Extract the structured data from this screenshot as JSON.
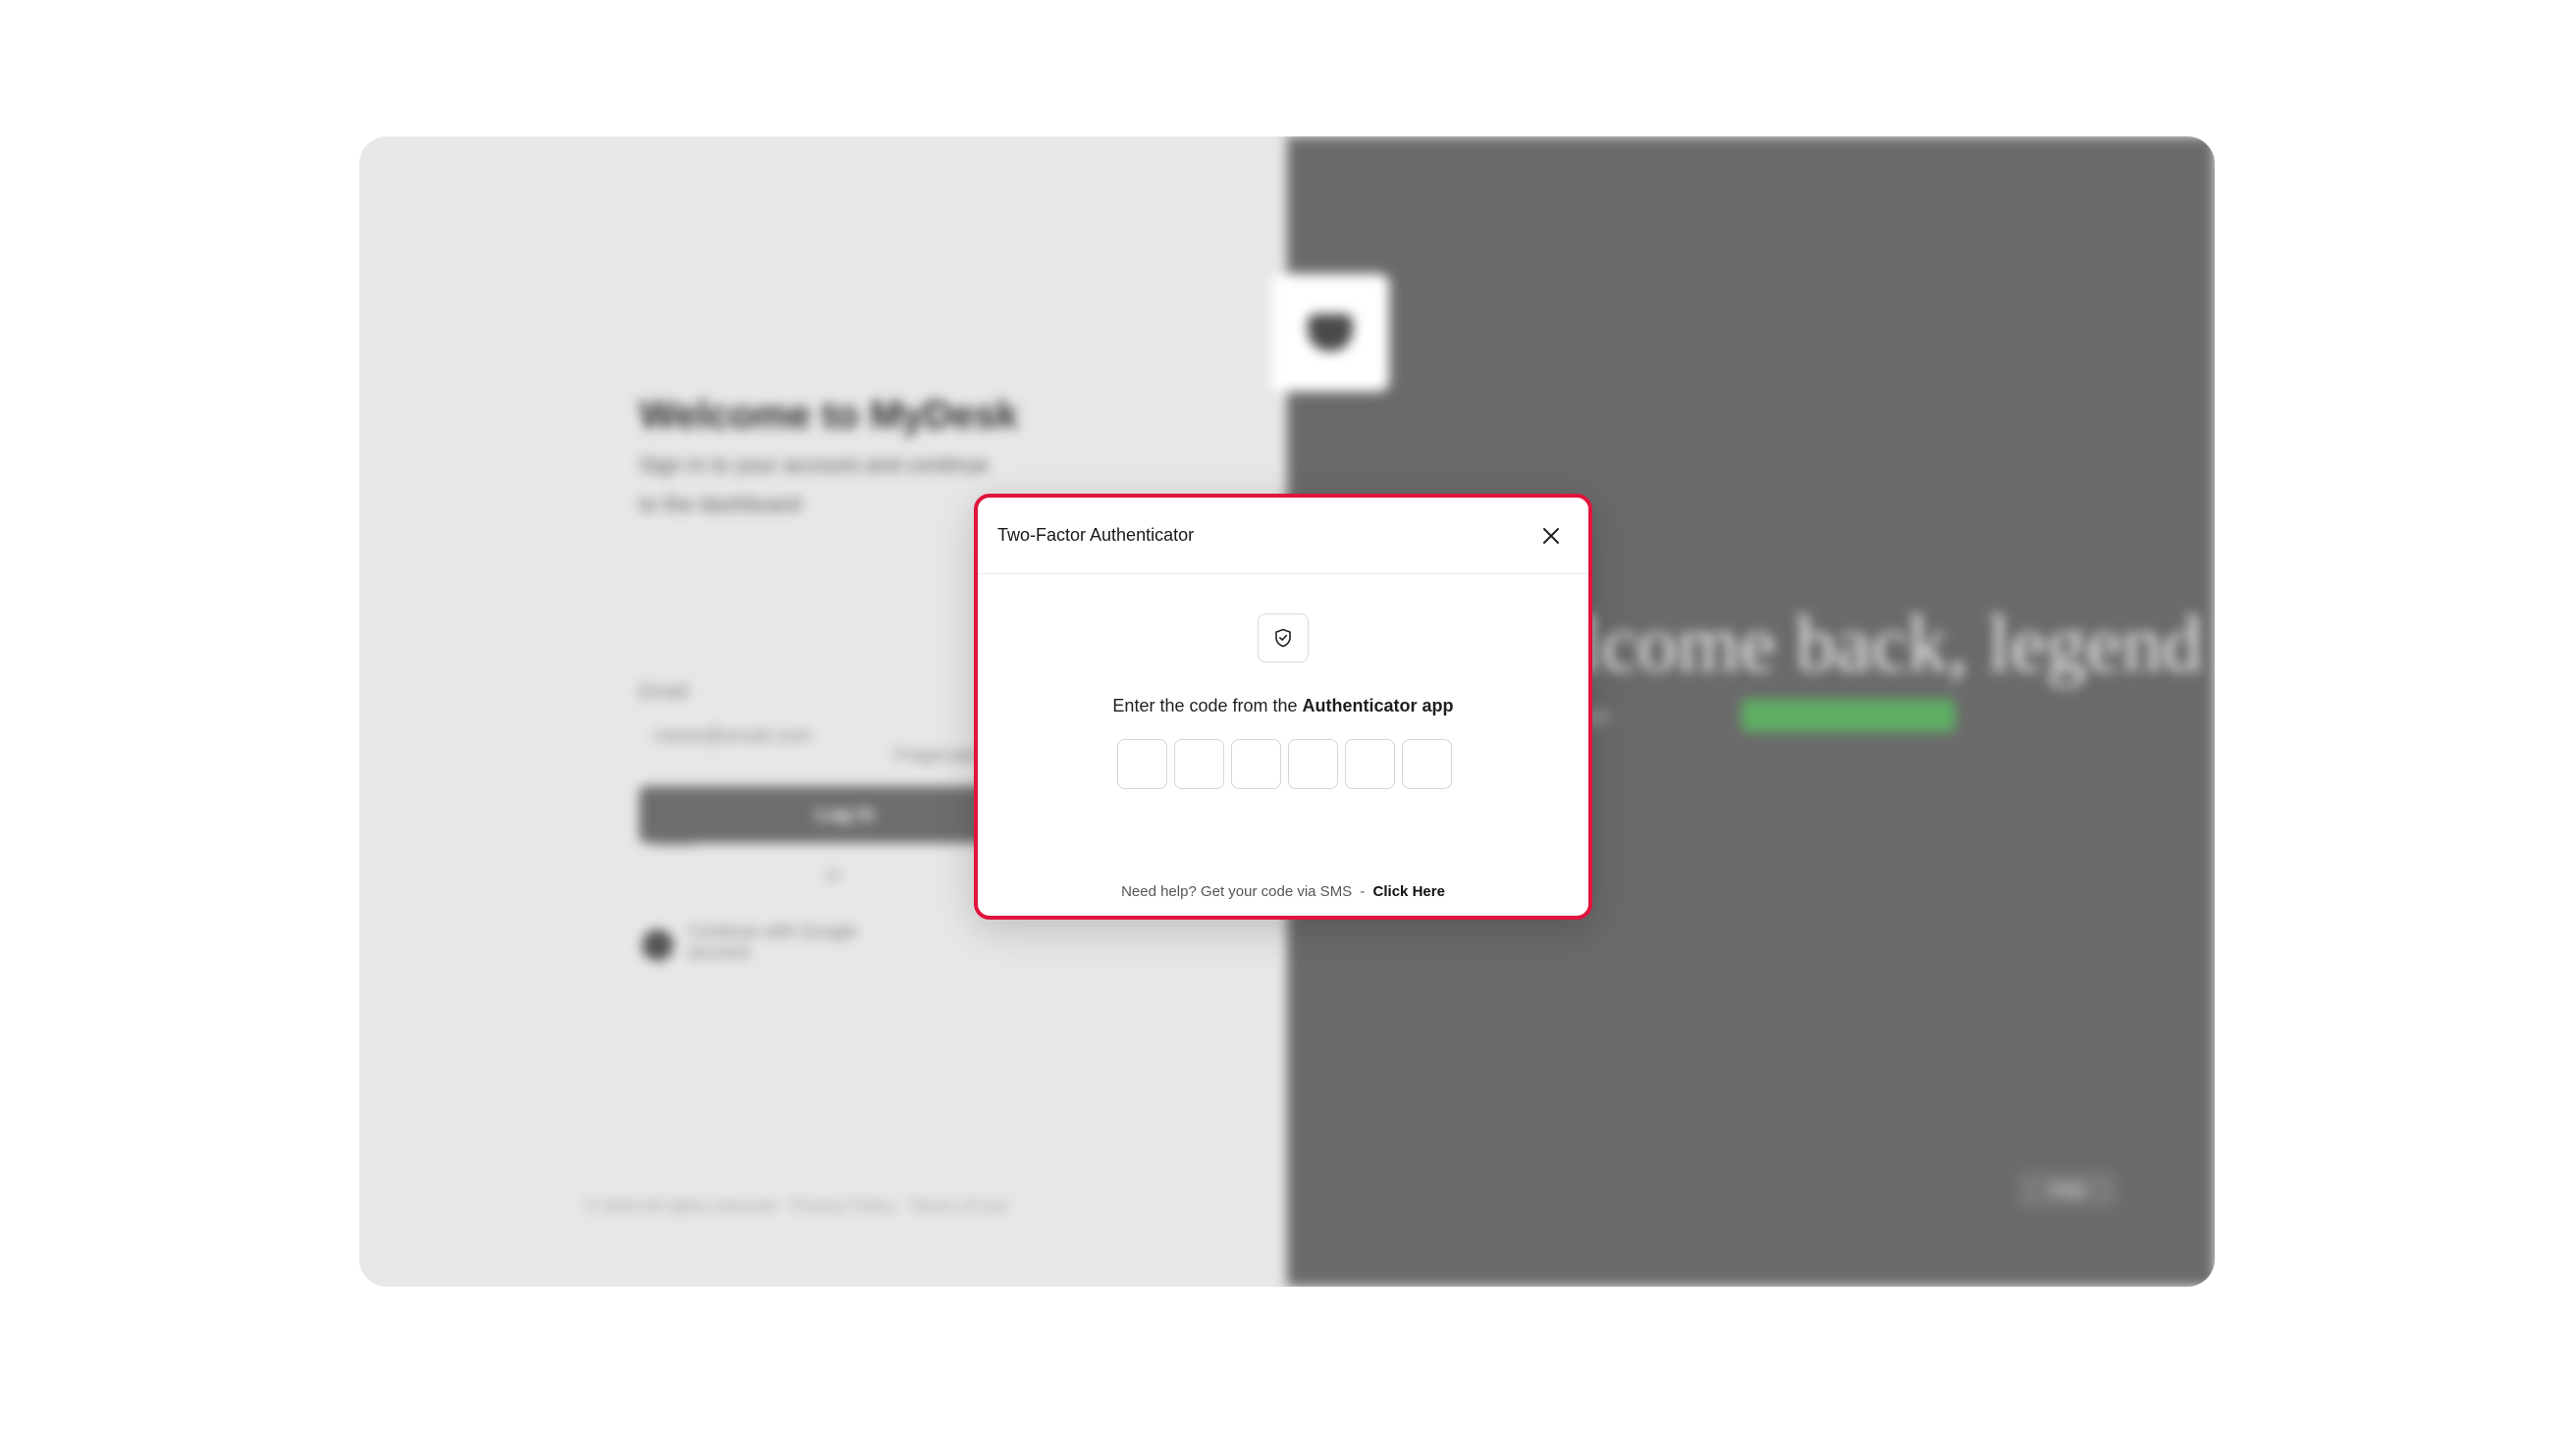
{
  "modal": {
    "title": "Two-Factor Authenticator",
    "instruction_prefix": "Enter the code from the",
    "instruction_emphasis": "Authenticator app",
    "code_length": 6,
    "help_text": "Need help? Get your code via SMS",
    "help_separator": "-",
    "help_link": "Click Here",
    "accent_color": "#e0143c"
  },
  "icons": {
    "close": "close-icon",
    "shield": "shield-check-icon"
  }
}
